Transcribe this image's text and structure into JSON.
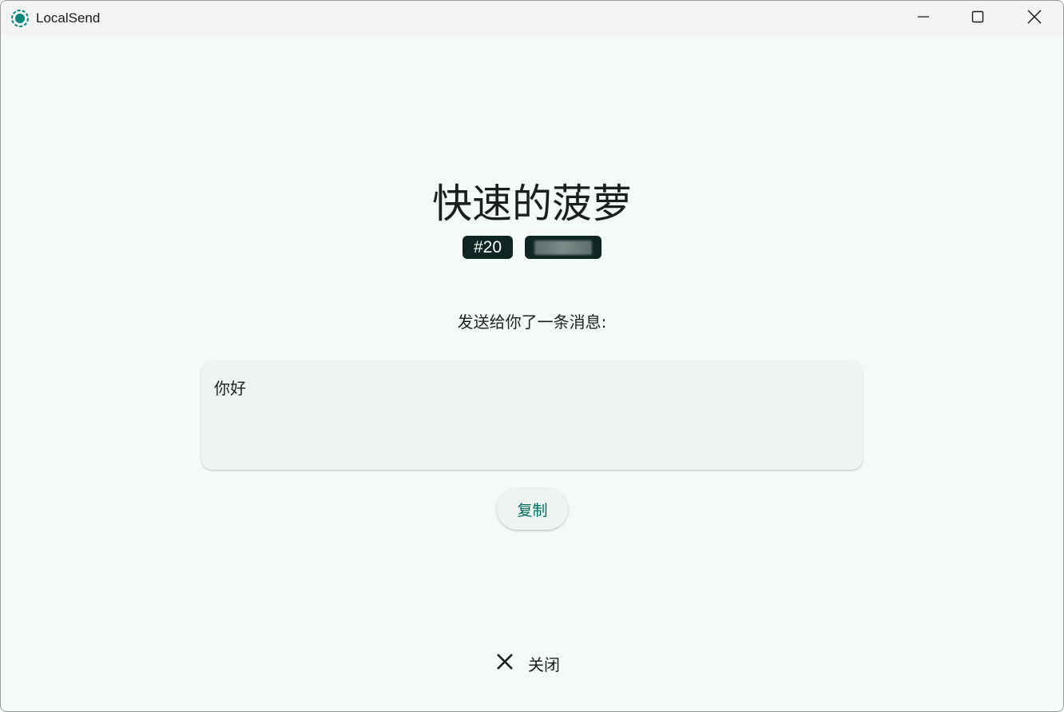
{
  "window": {
    "title": "LocalSend",
    "icon": "localsend-logo-icon",
    "controls": [
      "minimize-icon",
      "maximize-icon",
      "close-icon"
    ]
  },
  "device": {
    "name": "快速的菠萝",
    "badge_number": "#20",
    "badge_ip_redacted": true
  },
  "message": {
    "label": "发送给你了一条消息:",
    "text": "你好"
  },
  "actions": {
    "copy_label": "复制",
    "close_label": "关闭",
    "close_icon": "x-icon"
  },
  "colors": {
    "background": "#f4faf8",
    "titlebar": "#f3f3f3",
    "accent": "#006b5f",
    "badge_bg": "#0e2521",
    "message_box_bg": "#eff4f2",
    "logo": "#00897b"
  }
}
